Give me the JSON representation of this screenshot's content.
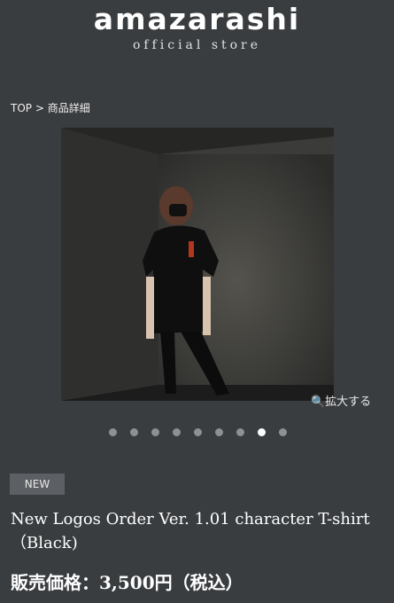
{
  "header": {
    "logo_text": "amazarashi",
    "logo_subtitle": "official store"
  },
  "breadcrumb": {
    "top": "TOP",
    "separator": ">",
    "current": "商品詳細"
  },
  "gallery": {
    "zoom_label": "🔍拡大する",
    "dot_count": 9,
    "active_index": 7
  },
  "product": {
    "badge": "NEW",
    "title": "New Logos Order Ver. 1.01 character T-shirt（Black)",
    "price": "販売価格：3,500円（税込）"
  },
  "colors": {
    "background": "#3a3d40",
    "dot_inactive": "#8d9094",
    "dot_active": "#ffffff",
    "badge_bg": "#5c5f63"
  }
}
